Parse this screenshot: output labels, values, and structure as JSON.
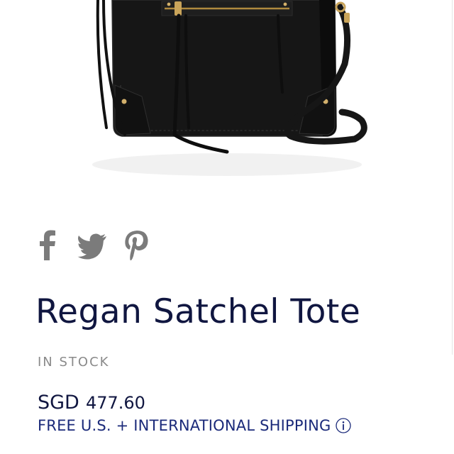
{
  "product": {
    "title": "Regan Satchel Tote",
    "stock_status": "IN STOCK",
    "price": {
      "currency": "SGD",
      "amount": "477.60"
    },
    "shipping_text": "FREE U.S. + INTERNATIONAL SHIPPING",
    "image": {
      "alt": "Regan Satchel Tote product photo",
      "color": "#111111"
    }
  },
  "share": {
    "icons": [
      "facebook-icon",
      "twitter-icon",
      "pinterest-icon"
    ],
    "icon_color": "#7b7b7b"
  },
  "colors": {
    "title": "#101640",
    "accent_link": "#1b2a7a",
    "muted": "#8a8a8a"
  }
}
